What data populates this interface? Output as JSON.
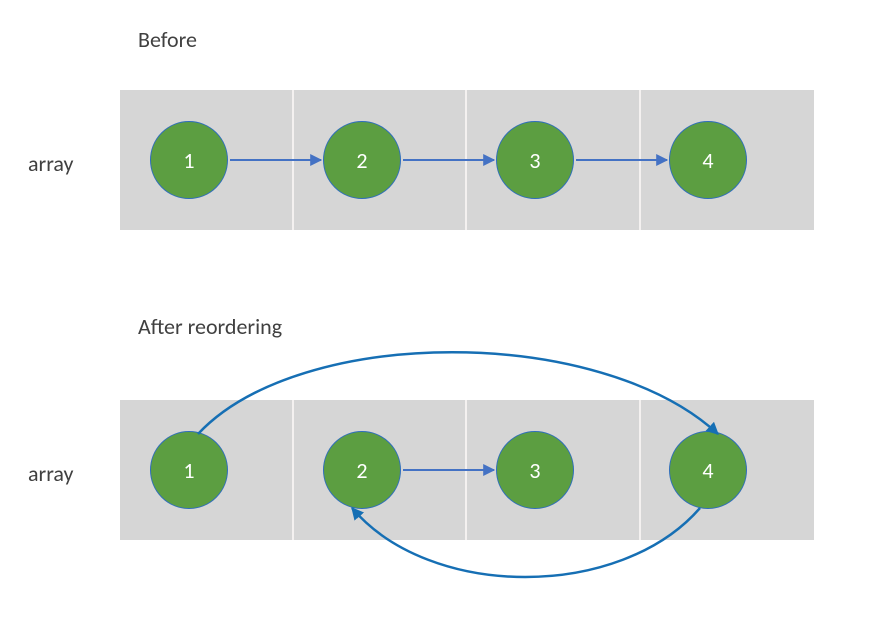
{
  "diagram": {
    "before": {
      "title": "Before",
      "array_label": "array",
      "nodes": [
        "1",
        "2",
        "3",
        "4"
      ],
      "edges": [
        [
          0,
          1
        ],
        [
          1,
          2
        ],
        [
          2,
          3
        ]
      ]
    },
    "after": {
      "title": "After reordering",
      "array_label": "array",
      "nodes": [
        "1",
        "2",
        "3",
        "4"
      ],
      "edges_straight": [
        [
          1,
          2
        ]
      ],
      "edges_curved": [
        [
          0,
          3
        ],
        [
          3,
          1
        ]
      ]
    },
    "colors": {
      "node_fill": "#5c9e41",
      "node_border": "#2f6eba",
      "arrow_straight": "#4472c4",
      "arrow_curved": "#166fb4",
      "array_bg": "#d6d6d6",
      "cell_divider": "#f4f1f0"
    }
  }
}
